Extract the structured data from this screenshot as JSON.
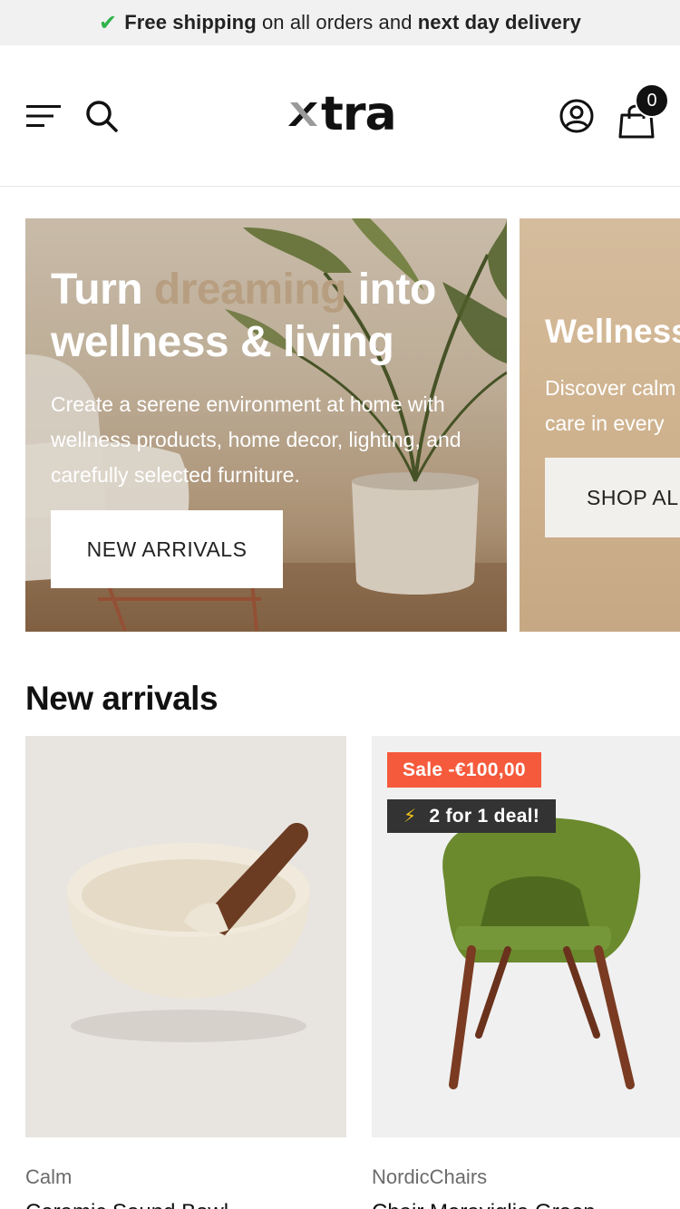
{
  "announcement": {
    "icon": "check-icon",
    "bold_1": "Free shipping",
    "text_1": " on all orders and ",
    "bold_2": "next day delivery"
  },
  "header": {
    "logo_text": "tra",
    "logo_mark": "x",
    "cart_count": "0",
    "icons": [
      "menu-icon",
      "search-icon",
      "account-icon",
      "cart-icon"
    ]
  },
  "slides": [
    {
      "title_before": "Turn ",
      "title_accent": "dreaming",
      "title_after": " into wellness & living",
      "text": "Create a serene environment at home with wellness products, home decor, lighting, and carefully selected furniture.",
      "button": "NEW ARRIVALS"
    },
    {
      "title": "Wellness",
      "text_line_1": "Discover calm",
      "text_line_2": "care in every",
      "button": "SHOP AL"
    }
  ],
  "new_arrivals": {
    "title": "New arrivals",
    "products": [
      {
        "vendor": "Calm",
        "title": "Ceramic Sound Bowl"
      },
      {
        "vendor": "NordicChairs",
        "title": "Chair Meraviglia Green",
        "sale_badge": "Sale -€100,00",
        "deal_badge": "2 for 1 deal!"
      }
    ]
  },
  "colors": {
    "accent_text": "#b79e80",
    "sale_badge": "#f55a3c",
    "deal_badge": "#333333",
    "check": "#2fb34a"
  }
}
